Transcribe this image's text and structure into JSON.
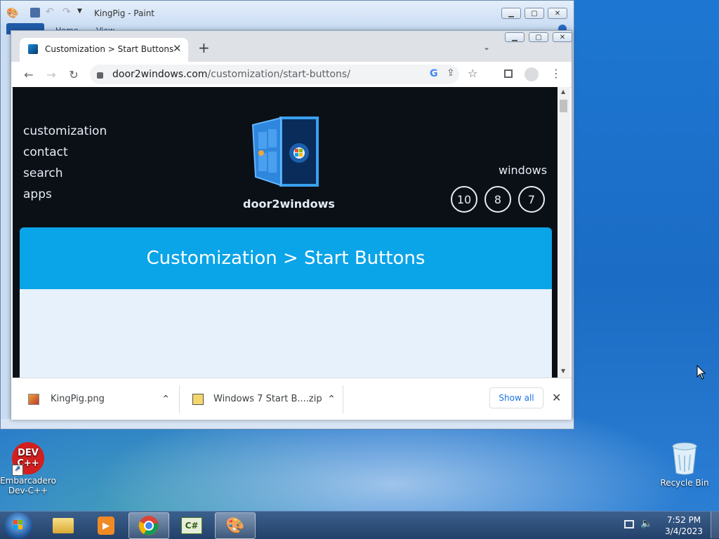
{
  "desktop": {
    "icons": [
      {
        "label_line1": "Embarcadero",
        "label_line2": "Dev-C++",
        "logo_line1": "DEV",
        "logo_line2": "C++"
      },
      {
        "label": "Recycle Bin"
      }
    ]
  },
  "paint": {
    "title": "KingPig - Paint",
    "ribbon_tabs": [
      "Home",
      "View"
    ]
  },
  "chrome": {
    "tab_title": "Customization > Start Buttons",
    "url_host": "door2windows.com",
    "url_path": "/customization/start-buttons/",
    "page": {
      "nav_links": [
        "customization",
        "contact",
        "search",
        "apps"
      ],
      "site_name": "door2windows",
      "windows_label": "windows",
      "version_buttons": [
        "10",
        "8",
        "7"
      ],
      "banner_title": "Customization > Start Buttons"
    },
    "downloads": {
      "items": [
        "KingPig.png",
        "Windows 7 Start B....zip"
      ],
      "show_all": "Show all"
    }
  },
  "taskbar": {
    "time": "7:52 PM",
    "date": "3/4/2023",
    "apps": [
      "explorer-icon",
      "media-player-icon",
      "chrome-icon",
      "csharp-icon",
      "paint-icon"
    ]
  }
}
